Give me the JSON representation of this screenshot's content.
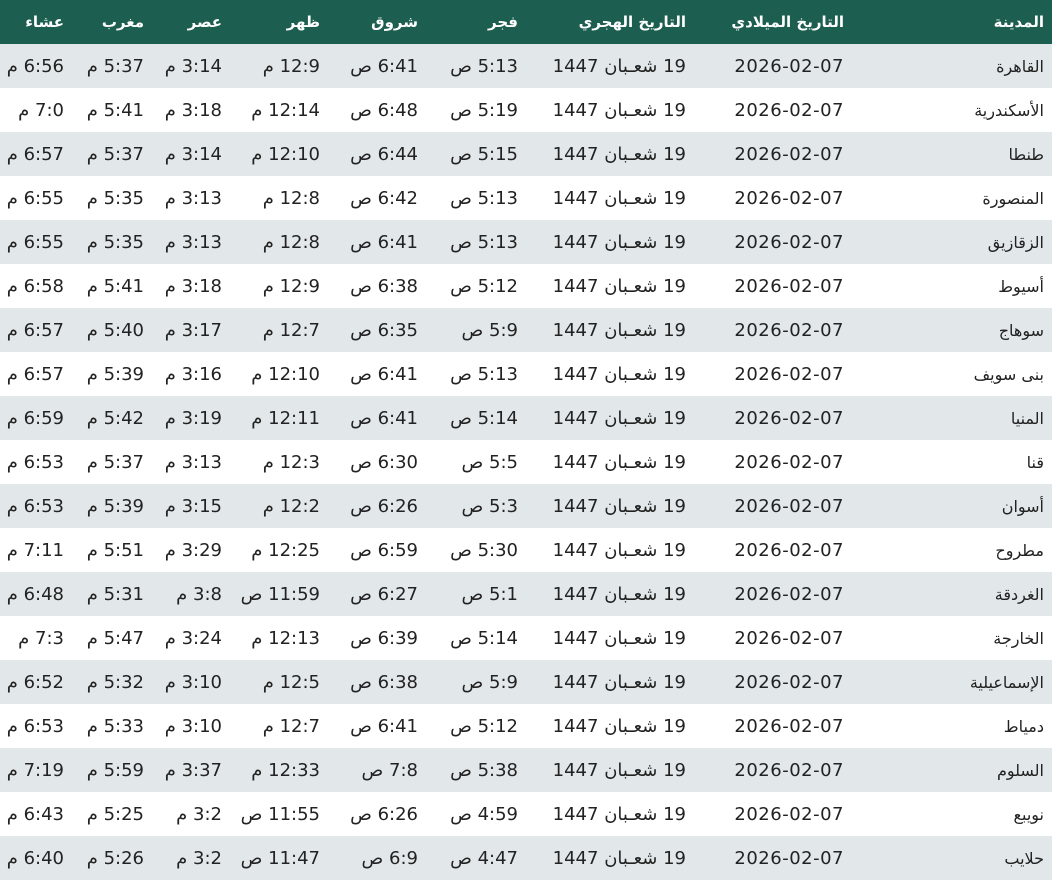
{
  "table": {
    "headers": {
      "city": "المدينة",
      "gregorian": "التاريخ الميلادي",
      "hijri": "التاريخ الهجري",
      "fajr": "فجر",
      "sunrise": "شروق",
      "dhuhr": "ظهر",
      "asr": "عصر",
      "maghrib": "مغرب",
      "isha": "عشاء"
    },
    "rows": [
      {
        "city": "القاهرة",
        "gregorian": "2026-02-07",
        "hijri": "19 شعـبان 1447",
        "fajr": "5:13 ص",
        "sunrise": "6:41 ص",
        "dhuhr": "12:9 م",
        "asr": "3:14 م",
        "maghrib": "5:37 م",
        "isha": "6:56 م"
      },
      {
        "city": "الأسكندرية",
        "gregorian": "2026-02-07",
        "hijri": "19 شعـبان 1447",
        "fajr": "5:19 ص",
        "sunrise": "6:48 ص",
        "dhuhr": "12:14 م",
        "asr": "3:18 م",
        "maghrib": "5:41 م",
        "isha": "7:0 م"
      },
      {
        "city": "طنطا",
        "gregorian": "2026-02-07",
        "hijri": "19 شعـبان 1447",
        "fajr": "5:15 ص",
        "sunrise": "6:44 ص",
        "dhuhr": "12:10 م",
        "asr": "3:14 م",
        "maghrib": "5:37 م",
        "isha": "6:57 م"
      },
      {
        "city": "المنصورة",
        "gregorian": "2026-02-07",
        "hijri": "19 شعـبان 1447",
        "fajr": "5:13 ص",
        "sunrise": "6:42 ص",
        "dhuhr": "12:8 م",
        "asr": "3:13 م",
        "maghrib": "5:35 م",
        "isha": "6:55 م"
      },
      {
        "city": "الزقازيق",
        "gregorian": "2026-02-07",
        "hijri": "19 شعـبان 1447",
        "fajr": "5:13 ص",
        "sunrise": "6:41 ص",
        "dhuhr": "12:8 م",
        "asr": "3:13 م",
        "maghrib": "5:35 م",
        "isha": "6:55 م"
      },
      {
        "city": "أسيوط",
        "gregorian": "2026-02-07",
        "hijri": "19 شعـبان 1447",
        "fajr": "5:12 ص",
        "sunrise": "6:38 ص",
        "dhuhr": "12:9 م",
        "asr": "3:18 م",
        "maghrib": "5:41 م",
        "isha": "6:58 م"
      },
      {
        "city": "سوهاج",
        "gregorian": "2026-02-07",
        "hijri": "19 شعـبان 1447",
        "fajr": "5:9 ص",
        "sunrise": "6:35 ص",
        "dhuhr": "12:7 م",
        "asr": "3:17 م",
        "maghrib": "5:40 م",
        "isha": "6:57 م"
      },
      {
        "city": "بنى سويف",
        "gregorian": "2026-02-07",
        "hijri": "19 شعـبان 1447",
        "fajr": "5:13 ص",
        "sunrise": "6:41 ص",
        "dhuhr": "12:10 م",
        "asr": "3:16 م",
        "maghrib": "5:39 م",
        "isha": "6:57 م"
      },
      {
        "city": "المنيا",
        "gregorian": "2026-02-07",
        "hijri": "19 شعـبان 1447",
        "fajr": "5:14 ص",
        "sunrise": "6:41 ص",
        "dhuhr": "12:11 م",
        "asr": "3:19 م",
        "maghrib": "5:42 م",
        "isha": "6:59 م"
      },
      {
        "city": "قنا",
        "gregorian": "2026-02-07",
        "hijri": "19 شعـبان 1447",
        "fajr": "5:5 ص",
        "sunrise": "6:30 ص",
        "dhuhr": "12:3 م",
        "asr": "3:13 م",
        "maghrib": "5:37 م",
        "isha": "6:53 م"
      },
      {
        "city": "أسوان",
        "gregorian": "2026-02-07",
        "hijri": "19 شعـبان 1447",
        "fajr": "5:3 ص",
        "sunrise": "6:26 ص",
        "dhuhr": "12:2 م",
        "asr": "3:15 م",
        "maghrib": "5:39 م",
        "isha": "6:53 م"
      },
      {
        "city": "مطروح",
        "gregorian": "2026-02-07",
        "hijri": "19 شعـبان 1447",
        "fajr": "5:30 ص",
        "sunrise": "6:59 ص",
        "dhuhr": "12:25 م",
        "asr": "3:29 م",
        "maghrib": "5:51 م",
        "isha": "7:11 م"
      },
      {
        "city": "الغردقة",
        "gregorian": "2026-02-07",
        "hijri": "19 شعـبان 1447",
        "fajr": "5:1 ص",
        "sunrise": "6:27 ص",
        "dhuhr": "11:59 ص",
        "asr": "3:8 م",
        "maghrib": "5:31 م",
        "isha": "6:48 م"
      },
      {
        "city": "الخارجة",
        "gregorian": "2026-02-07",
        "hijri": "19 شعـبان 1447",
        "fajr": "5:14 ص",
        "sunrise": "6:39 ص",
        "dhuhr": "12:13 م",
        "asr": "3:24 م",
        "maghrib": "5:47 م",
        "isha": "7:3 م"
      },
      {
        "city": "الإسماعيلية",
        "gregorian": "2026-02-07",
        "hijri": "19 شعـبان 1447",
        "fajr": "5:9 ص",
        "sunrise": "6:38 ص",
        "dhuhr": "12:5 م",
        "asr": "3:10 م",
        "maghrib": "5:32 م",
        "isha": "6:52 م"
      },
      {
        "city": "دمياط",
        "gregorian": "2026-02-07",
        "hijri": "19 شعـبان 1447",
        "fajr": "5:12 ص",
        "sunrise": "6:41 ص",
        "dhuhr": "12:7 م",
        "asr": "3:10 م",
        "maghrib": "5:33 م",
        "isha": "6:53 م"
      },
      {
        "city": "السلوم",
        "gregorian": "2026-02-07",
        "hijri": "19 شعـبان 1447",
        "fajr": "5:38 ص",
        "sunrise": "7:8 ص",
        "dhuhr": "12:33 م",
        "asr": "3:37 م",
        "maghrib": "5:59 م",
        "isha": "7:19 م"
      },
      {
        "city": "نويبع",
        "gregorian": "2026-02-07",
        "hijri": "19 شعـبان 1447",
        "fajr": "4:59 ص",
        "sunrise": "6:26 ص",
        "dhuhr": "11:55 ص",
        "asr": "3:2 م",
        "maghrib": "5:25 م",
        "isha": "6:43 م"
      },
      {
        "city": "حلايب",
        "gregorian": "2026-02-07",
        "hijri": "19 شعـبان 1447",
        "fajr": "4:47 ص",
        "sunrise": "6:9 ص",
        "dhuhr": "11:47 ص",
        "asr": "3:2 م",
        "maghrib": "5:26 م",
        "isha": "6:40 م"
      }
    ]
  }
}
